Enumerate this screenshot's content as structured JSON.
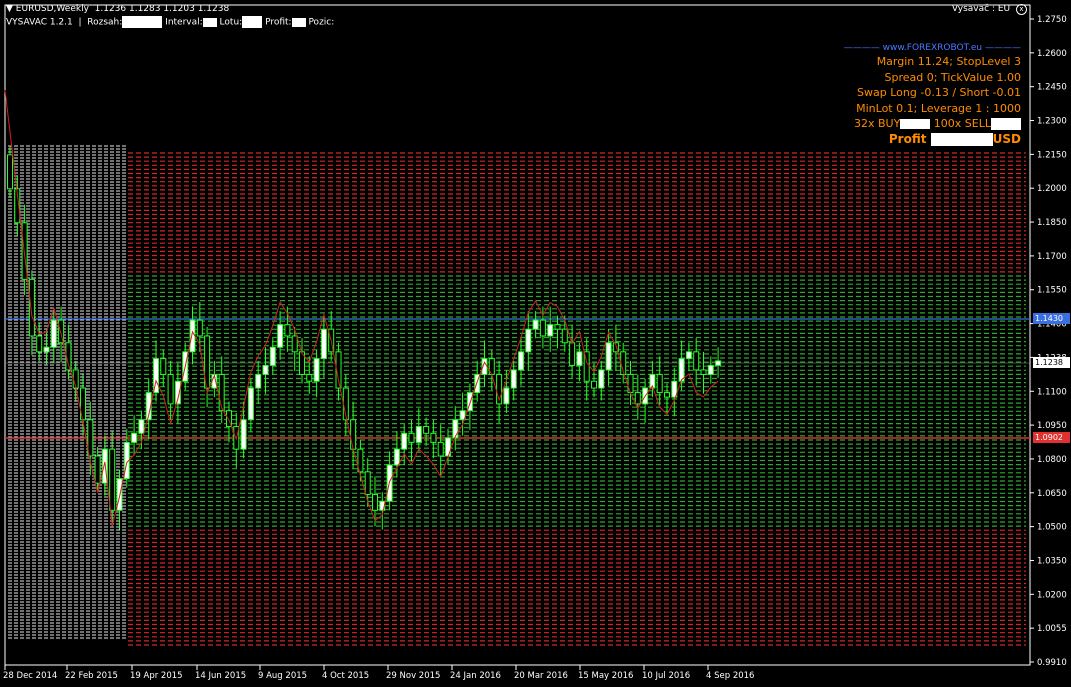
{
  "chart_header": {
    "symbol_tf": "EURUSD,Weekly",
    "ohlc": "1.1236 1.1283 1.1203 1.1238",
    "ea_label": "VYSAVAC 1.2.1",
    "sep": "|",
    "fields": [
      "Rozsah:",
      "Interval:",
      "Lotu:",
      "Profit:",
      "Pozic:"
    ]
  },
  "top_right": {
    "label": "Vysavač : EU",
    "close_glyph": "x"
  },
  "ea_panel": {
    "site": "www.FOREXROBOT.eu",
    "margin": "Margin 11.24; StopLevel 3",
    "spread": "Spread 0; TickValue 1.00",
    "swap": "Swap Long -0.13 / Short -0.01",
    "minlot": "MinLot 0.1; Leverage 1 : 1000",
    "positions_prefix": "32x BUY",
    "positions_mid": "100x SELL",
    "profit_prefix": "Profit",
    "profit_suffix": "USD"
  },
  "price_axis": [
    "1.2750",
    "1.2600",
    "1.2450",
    "1.2300",
    "1.2150",
    "1.2000",
    "1.1850",
    "1.1700",
    "1.1550",
    "1.1400",
    "1.1238",
    "1.1100",
    "1.0950",
    "1.0800",
    "1.0650",
    "1.0500",
    "1.0350",
    "1.0200",
    "1.0055",
    "0.9910"
  ],
  "price_tags": {
    "blue": {
      "value": "1.1430",
      "color": "#3a6fe0"
    },
    "current": {
      "value": "1.1238",
      "color": "#000000"
    },
    "red": {
      "value": "1.0902",
      "color": "#e03030"
    }
  },
  "time_axis": [
    "28 Dec 2014",
    "22 Feb 2015",
    "19 Apr 2015",
    "14 Jun 2015",
    "9 Aug 2015",
    "4 Oct 2015",
    "29 Nov 2015",
    "24 Jan 2016",
    "20 Mar 2016",
    "15 May 2016",
    "10 Jul 2016",
    "4 Sep 2016"
  ],
  "colors": {
    "grid_red": "#d02828",
    "grid_green": "#2ea82e",
    "candle": "#22ff22",
    "bull_body": "#ffffff",
    "ma": "#d02020"
  }
}
